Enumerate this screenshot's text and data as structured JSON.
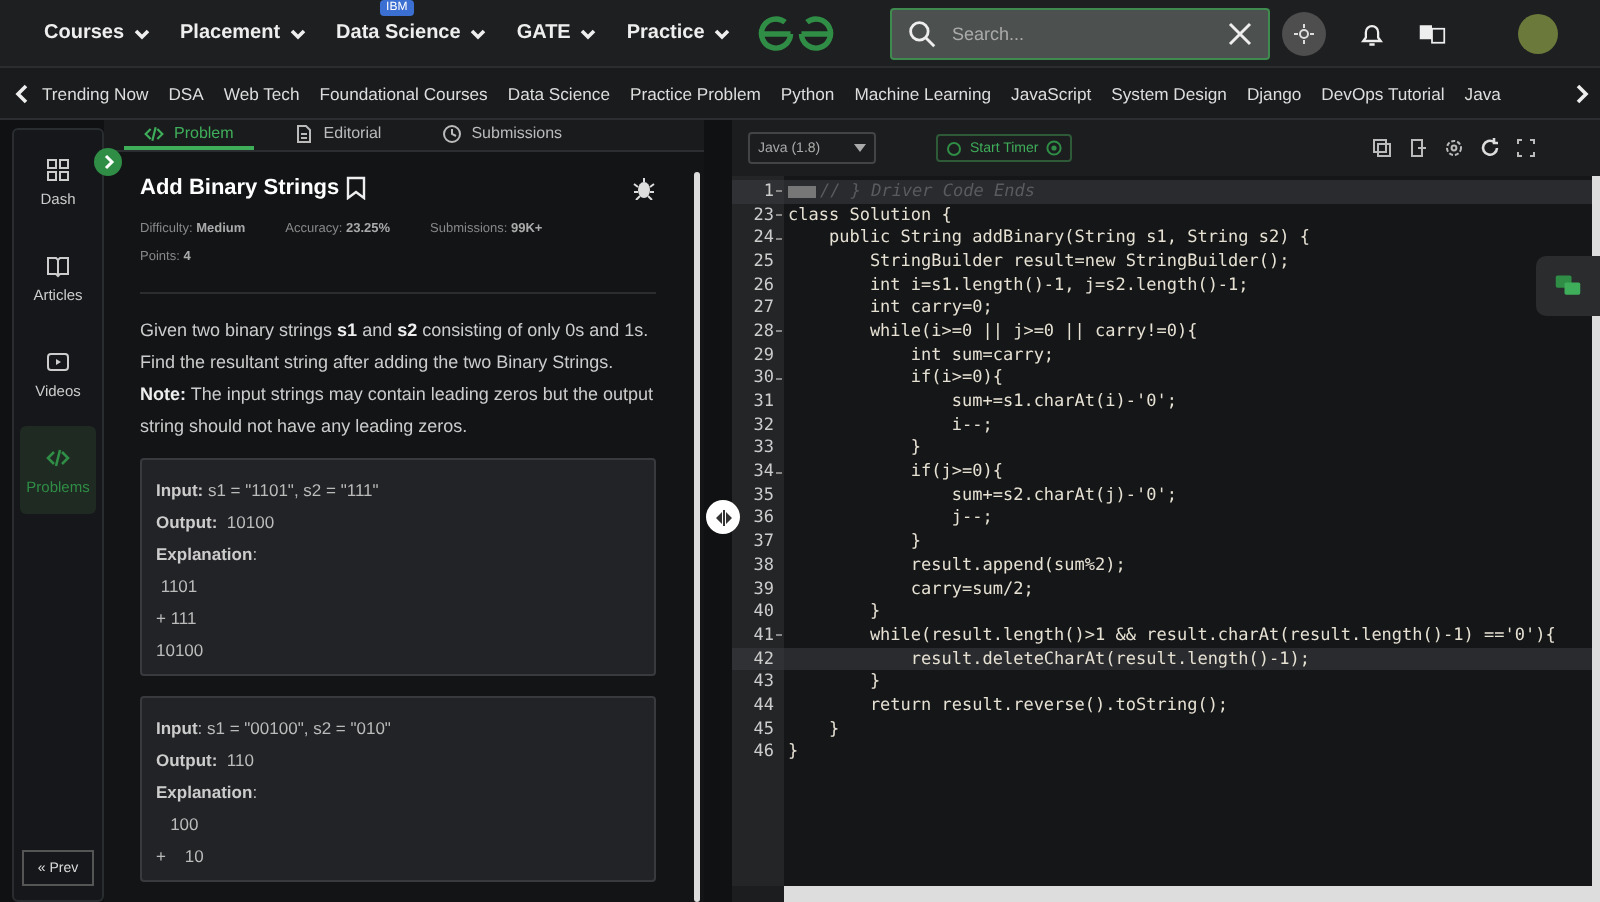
{
  "top_nav": {
    "menus": [
      {
        "label": "Courses"
      },
      {
        "label": "Placement"
      },
      {
        "label": "Data Science",
        "badge": "IBM"
      },
      {
        "label": "GATE"
      },
      {
        "label": "Practice"
      }
    ],
    "search": {
      "placeholder": "Search..."
    }
  },
  "sub_nav": [
    "Trending Now",
    "DSA",
    "Web Tech",
    "Foundational Courses",
    "Data Science",
    "Practice Problem",
    "Python",
    "Machine Learning",
    "JavaScript",
    "System Design",
    "Django",
    "DevOps Tutorial",
    "Java"
  ],
  "sidebar": {
    "items": [
      {
        "label": "Dash",
        "selected": false
      },
      {
        "label": "Articles",
        "selected": false
      },
      {
        "label": "Videos",
        "selected": false
      },
      {
        "label": "Problems",
        "selected": true
      }
    ],
    "prev_button": "« Prev"
  },
  "tabs": [
    {
      "label": "Problem",
      "selected": true
    },
    {
      "label": "Editorial",
      "selected": false
    },
    {
      "label": "Submissions",
      "selected": false
    }
  ],
  "problem": {
    "title": "Add Binary Strings",
    "meta": [
      {
        "label": "Difficulty:",
        "value": "Medium"
      },
      {
        "label": "Accuracy:",
        "value": "23.25%"
      },
      {
        "label": "Submissions:",
        "value": "99K+"
      },
      {
        "label": "Points:",
        "value": "4"
      }
    ],
    "description": "Given two binary strings **s1** and **s2** consisting of only 0s and 1s. Find the resultant string after adding the two Binary Strings.\n**Note:** The input strings may contain leading zeros but the output string should not have any leading zeros.",
    "examples": [
      [
        "**Input:** s1 = \"1101\", s2 = \"111\"",
        "**Output:**  10100",
        "**Explanation**:",
        " 1101",
        "+ 111",
        "10100"
      ],
      [
        "**Input**: s1 = \"00100\", s2 = \"010\"",
        "**Output:**  110",
        "**Explanation**:",
        "   100",
        "+    10"
      ]
    ]
  },
  "editor": {
    "language": "Java (1.8)",
    "timer_button": "Start Timer",
    "lines": [
      {
        "number": "1",
        "text": "// } Driver Code Ends",
        "kind": "comment",
        "foldable": true,
        "highlighted": true
      },
      {
        "number": "23",
        "text": "class Solution {",
        "kind": "code",
        "foldable": true,
        "highlighted": false
      },
      {
        "number": "24",
        "text": "    public String addBinary(String s1, String s2) {",
        "kind": "code",
        "foldable": true,
        "highlighted": false
      },
      {
        "number": "25",
        "text": "        StringBuilder result=new StringBuilder();",
        "kind": "code",
        "foldable": false,
        "highlighted": false
      },
      {
        "number": "26",
        "text": "        int i=s1.length()-1, j=s2.length()-1;",
        "kind": "code",
        "foldable": false,
        "highlighted": false
      },
      {
        "number": "27",
        "text": "        int carry=0;",
        "kind": "code",
        "foldable": false,
        "highlighted": false
      },
      {
        "number": "28",
        "text": "        while(i>=0 || j>=0 || carry!=0){",
        "kind": "code",
        "foldable": true,
        "highlighted": false
      },
      {
        "number": "29",
        "text": "            int sum=carry;",
        "kind": "code",
        "foldable": false,
        "highlighted": false
      },
      {
        "number": "30",
        "text": "            if(i>=0){",
        "kind": "code",
        "foldable": true,
        "highlighted": false
      },
      {
        "number": "31",
        "text": "                sum+=s1.charAt(i)-'0';",
        "kind": "code",
        "foldable": false,
        "highlighted": false
      },
      {
        "number": "32",
        "text": "                i--;",
        "kind": "code",
        "foldable": false,
        "highlighted": false
      },
      {
        "number": "33",
        "text": "            }",
        "kind": "code",
        "foldable": false,
        "highlighted": false
      },
      {
        "number": "34",
        "text": "            if(j>=0){",
        "kind": "code",
        "foldable": true,
        "highlighted": false
      },
      {
        "number": "35",
        "text": "                sum+=s2.charAt(j)-'0';",
        "kind": "code",
        "foldable": false,
        "highlighted": false
      },
      {
        "number": "36",
        "text": "                j--;",
        "kind": "code",
        "foldable": false,
        "highlighted": false
      },
      {
        "number": "37",
        "text": "            }",
        "kind": "code",
        "foldable": false,
        "highlighted": false
      },
      {
        "number": "38",
        "text": "            result.append(sum%2);",
        "kind": "code",
        "foldable": false,
        "highlighted": false
      },
      {
        "number": "39",
        "text": "            carry=sum/2;",
        "kind": "code",
        "foldable": false,
        "highlighted": false
      },
      {
        "number": "40",
        "text": "        }",
        "kind": "code",
        "foldable": false,
        "highlighted": false
      },
      {
        "number": "41",
        "text": "        while(result.length()>1 && result.charAt(result.length()-1) =='0'){",
        "kind": "code",
        "foldable": true,
        "highlighted": false
      },
      {
        "number": "42",
        "text": "            result.deleteCharAt(result.length()-1);",
        "kind": "code",
        "foldable": false,
        "highlighted": true
      },
      {
        "number": "43",
        "text": "        }",
        "kind": "code",
        "foldable": false,
        "highlighted": false
      },
      {
        "number": "44",
        "text": "        return result.reverse().toString();",
        "kind": "code",
        "foldable": false,
        "highlighted": false
      },
      {
        "number": "45",
        "text": "    }",
        "kind": "code",
        "foldable": false,
        "highlighted": false
      },
      {
        "number": "46",
        "text": "}",
        "kind": "code",
        "foldable": false,
        "highlighted": false
      }
    ]
  }
}
